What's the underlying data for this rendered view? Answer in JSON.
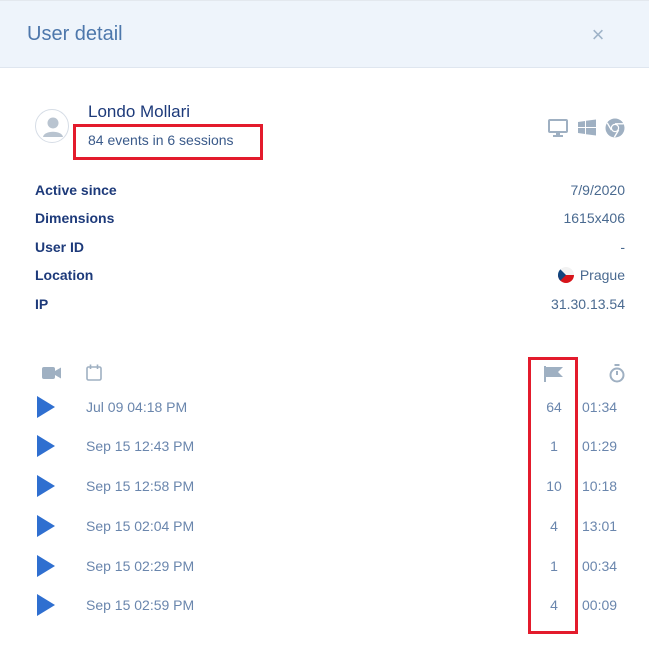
{
  "dialog": {
    "title": "User detail",
    "close_glyph": "×"
  },
  "user": {
    "name": "Londo Mollari",
    "summary": "84 events in 6 sessions",
    "avatar_icon": "user-avatar-icon",
    "environment": [
      "desktop-icon",
      "windows-icon",
      "chrome-icon"
    ]
  },
  "info": [
    {
      "label": "Active since",
      "value": "7/9/2020"
    },
    {
      "label": "Dimensions",
      "value": "1615x406"
    },
    {
      "label": "User ID",
      "value": "-"
    },
    {
      "label": "Location",
      "value": "Prague",
      "flag": "czech-flag-icon"
    },
    {
      "label": "IP",
      "value": "31.30.13.54"
    }
  ],
  "sessions_header": [
    "video-icon",
    "calendar-icon",
    "flag-icon",
    "stopwatch-icon"
  ],
  "sessions": [
    {
      "date": "Jul 09  04:18 PM",
      "events": "64",
      "duration": "01:34"
    },
    {
      "date": "Sep 15  12:43 PM",
      "events": "1",
      "duration": "01:29"
    },
    {
      "date": "Sep 15  12:58 PM",
      "events": "10",
      "duration": "10:18"
    },
    {
      "date": "Sep 15  02:04 PM",
      "events": "4",
      "duration": "13:01"
    },
    {
      "date": "Sep 15  02:29 PM",
      "events": "1",
      "duration": "00:34"
    },
    {
      "date": "Sep 15  02:59 PM",
      "events": "4",
      "duration": "00:09"
    }
  ],
  "colors": {
    "highlight": "#e31b2c",
    "accent": "#2f6fd0",
    "header_bg": "#eef4fb"
  }
}
